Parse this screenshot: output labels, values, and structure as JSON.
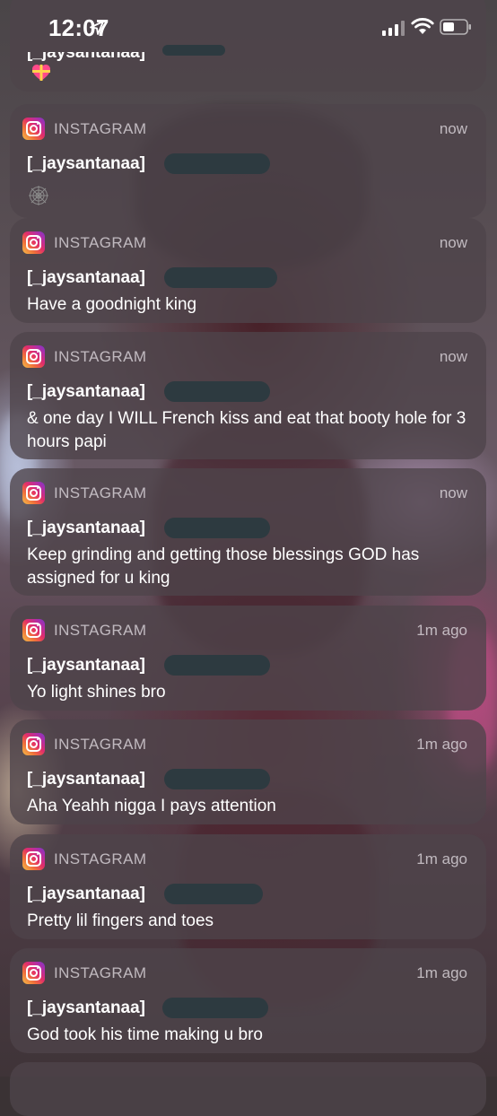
{
  "status_bar": {
    "time": "12:07",
    "location_icon": "location-arrow-icon",
    "signal_icon": "cellular-signal-icon",
    "wifi_icon": "wifi-icon",
    "battery_icon": "battery-icon"
  },
  "top_partial": {
    "title_fragment": "[_jaysantanaa]",
    "emoji": "gift-heart-emoji"
  },
  "notifications": [
    {
      "app": "INSTAGRAM",
      "time": "now",
      "sender": "[_jaysantanaa]",
      "body": "",
      "emoji": "spider-web-emoji"
    },
    {
      "app": "INSTAGRAM",
      "time": "now",
      "sender": "[_jaysantanaa]",
      "body": "Have a goodnight king"
    },
    {
      "app": "INSTAGRAM",
      "time": "now",
      "sender": "[_jaysantanaa]",
      "body": "& one day I WILL French kiss and eat that booty hole for 3 hours papi"
    },
    {
      "app": "INSTAGRAM",
      "time": "now",
      "sender": "[_jaysantanaa]",
      "body": "Keep grinding and getting those blessings GOD has assigned for u king"
    },
    {
      "app": "INSTAGRAM",
      "time": "1m ago",
      "sender": "[_jaysantanaa]",
      "body": "Yo light shines bro"
    },
    {
      "app": "INSTAGRAM",
      "time": "1m ago",
      "sender": "[_jaysantanaa]",
      "body": "Aha Yeahh nigga I pays attention"
    },
    {
      "app": "INSTAGRAM",
      "time": "1m ago",
      "sender": "[_jaysantanaa]",
      "body": "Pretty lil fingers and toes"
    },
    {
      "app": "INSTAGRAM",
      "time": "1m ago",
      "sender": "[_jaysantanaa]",
      "body": "God took his time making u bro"
    }
  ],
  "colors": {
    "card_bg": "#4e444a",
    "redaction": "#2d3a40",
    "meta_text": "#ebe6eb",
    "instagram_gradient": [
      "#f5c04a",
      "#e22d6a",
      "#7638c9"
    ]
  }
}
